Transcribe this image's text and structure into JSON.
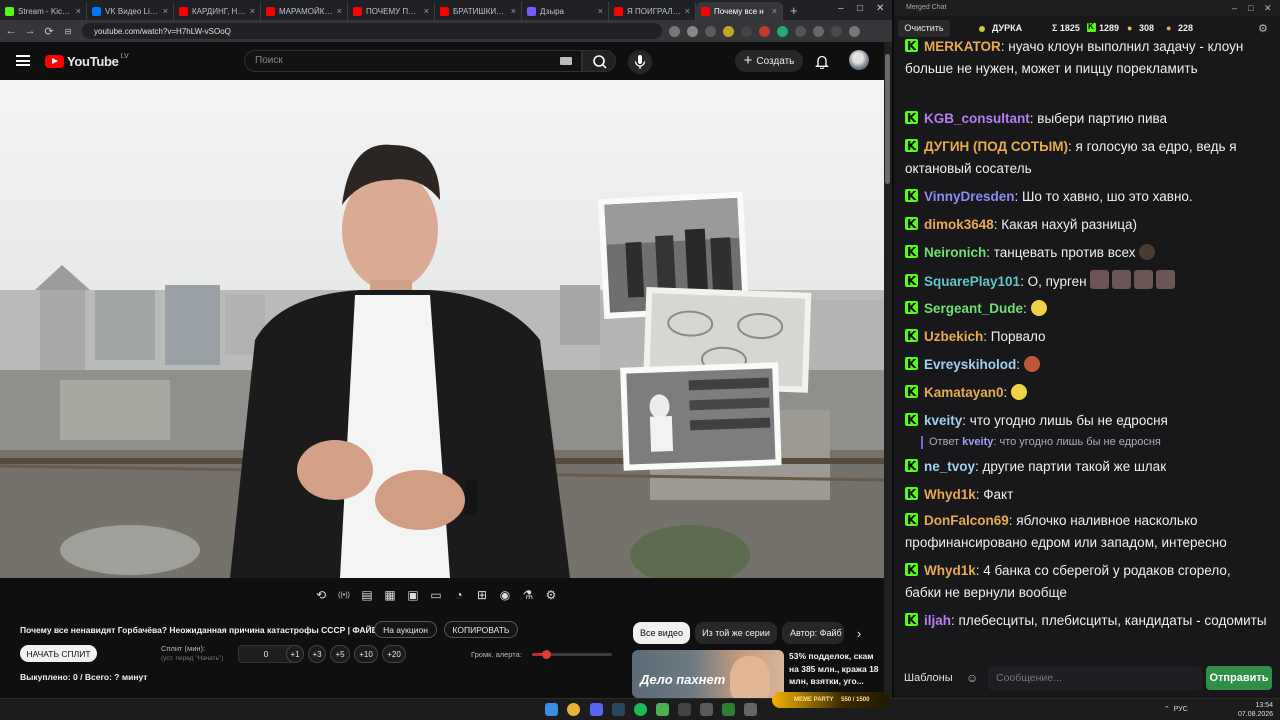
{
  "browser": {
    "tabs": [
      {
        "label": "Stream - Kick Das",
        "color": "#53fc18"
      },
      {
        "label": "VK Видео Live —",
        "color": "#0077ff"
      },
      {
        "label": "КАРДИНГ, НАКРУ",
        "color": "#ff0000"
      },
      {
        "label": "МАРАМОЙКИ УЧ",
        "color": "#ff0000"
      },
      {
        "label": "ПОЧЕМУ ПАПА Д",
        "color": "#ff0000"
      },
      {
        "label": "БРАТИШКИН СО",
        "color": "#ff0000"
      },
      {
        "label": "Дзыра",
        "color": "#7a5af8"
      },
      {
        "label": "Я ПОИГРАЛ В Wi",
        "color": "#ff0000"
      },
      {
        "label": "Почему все н",
        "color": "#ff0000",
        "active": true
      }
    ],
    "new_tab": "+",
    "url": "youtube.com/watch?v=H7hLW-vSOoQ"
  },
  "youtube": {
    "logo": "YouTube",
    "country": "LV",
    "search_placeholder": "Поиск",
    "create_label": "Создать",
    "controls": [
      "repeat-icon",
      "broadcast-icon",
      "subtitles-icon",
      "clapper-icon",
      "pip-icon",
      "theater-icon",
      "speed-icon",
      "add-icon",
      "camera-icon",
      "flask-icon",
      "settings-icon"
    ],
    "video_title": "Почему все ненавидят Горбачёва? Неожиданная причина катастрофы СССР | ФАЙБ",
    "auction_label": "На аукцион",
    "copy_label": "КОПИРОВАТЬ",
    "start_split_label": "НАЧАТЬ СПЛИТ",
    "split_label": "Сплит (мин):",
    "split_sub": "(уст. перед \"Начать\")",
    "split_value": "0",
    "increments": [
      "+1",
      "+3",
      "+5",
      "+10",
      "+20"
    ],
    "alert_volume_label": "Громк. алерта:",
    "alert_volume": 0.18,
    "bought_label": "Выкуплено: 0 / Всего: ? минут",
    "chips": [
      "Все видео",
      "Из той же серии",
      "Автор: Файб"
    ],
    "rec_thumb_text": "Дело пахнет",
    "rec_desc": "53% подделок, скам на 385 млн., кража 18 млн, взятки, уго..."
  },
  "chat": {
    "window_title": "Merged Chat",
    "clear_label": "Очистить",
    "streamer": "ДУРКА",
    "total": "Σ 1825",
    "kick_count": "1289",
    "other_count": "308",
    "third_count": "228",
    "messages": [
      {
        "user": "MERKATOR",
        "color": "#e8a951",
        "text": ": нуачо клоун выполнил задачу - клоун больше не нужен, может и пиццу порекламить"
      },
      {
        "user": "KGB_consultant",
        "color": "#b67ef2",
        "text": ": выбери партию пива"
      },
      {
        "user": "ДУГИН (ПОД СОТЫМ)",
        "color": "#e8a951",
        "text": ": я голосую за едро, ведь я октановый сосатель"
      },
      {
        "user": "VinnyDresden",
        "color": "#8a8cf2",
        "text": ": Шо то хавно, шо это хавно."
      },
      {
        "user": "dimok3648",
        "color": "#e8a951",
        "text": ": Какая нахуй разница)"
      },
      {
        "user": "Neironich",
        "color": "#6fe06f",
        "text": ": танцевать против всех"
      },
      {
        "user": "SquarePlay101",
        "color": "#5cc8c8",
        "text": ": О, пурген"
      },
      {
        "user": "Sergeant_Dude",
        "color": "#6fe06f",
        "text": ":"
      },
      {
        "user": "Uzbekich",
        "color": "#e8a951",
        "text": ": Порвало"
      },
      {
        "user": "Evreyskiholod",
        "color": "#9fd0f0",
        "text": ":"
      },
      {
        "user": "Kamatayan0",
        "color": "#e8a951",
        "text": ":"
      },
      {
        "user": "kveity",
        "color": "#9fd0f0",
        "text": ": что угодно лишь бы не едросня"
      },
      {
        "user": "ne_tvoy",
        "color": "#9fd0f0",
        "text": ": другие партии такой же шлак"
      },
      {
        "user": "Whyd1k",
        "color": "#e8a951",
        "text": ": Факт"
      },
      {
        "user": "DonFalcon69",
        "color": "#e8a951",
        "text": ": яблочко наливное насколько профинансировано едром или западом, интересно"
      },
      {
        "user": "Whyd1k",
        "color": "#e8a951",
        "text": ": 4 банка со сберегой у родаков сгорело, бабки не вернули вообще"
      },
      {
        "user": "iljah",
        "color": "#b67ef2",
        "text": ": плебесциты, плебисциты, кандидаты - содомиты"
      }
    ],
    "reply": {
      "prefix": "Ответ",
      "user": "kveity",
      "text": ": что угодно лишь бы не едросня"
    },
    "templates_label": "Шаблоны",
    "input_placeholder": "Сообщение...",
    "send_label": "Отправить"
  },
  "taskbar": {
    "lang": "РУС",
    "time": "13:54",
    "date": "07.08.2026",
    "meme_label": "MEME PARTY",
    "meme_count": "550 / 1500"
  }
}
